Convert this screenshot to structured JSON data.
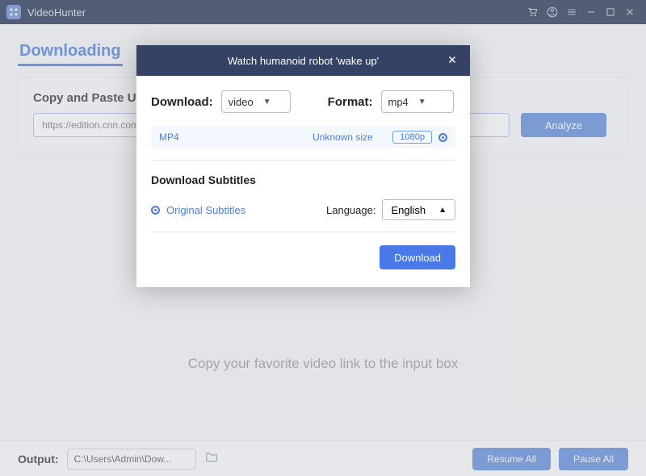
{
  "app": {
    "name": "VideoHunter"
  },
  "tabs": {
    "downloading": "Downloading"
  },
  "card": {
    "title": "Copy and Paste URL here",
    "url_placeholder": "https://edition.cnn.com",
    "analyze": "Analyze"
  },
  "hint": "Copy your favorite video link to the input box",
  "footer": {
    "output_label": "Output:",
    "path": "C:\\Users\\Admin\\Dow...",
    "resume": "Resume All",
    "pause": "Pause All"
  },
  "dialog": {
    "title": "Watch humanoid robot 'wake up'",
    "download_label": "Download:",
    "download_value": "video",
    "format_label": "Format:",
    "format_value": "mp4",
    "row": {
      "type": "MP4",
      "size": "Unknown size",
      "res": "1080p"
    },
    "subtitles_title": "Download Subtitles",
    "original_subs": "Original Subtitles",
    "language_label": "Language:",
    "language_value": "English",
    "download_btn": "Download"
  }
}
